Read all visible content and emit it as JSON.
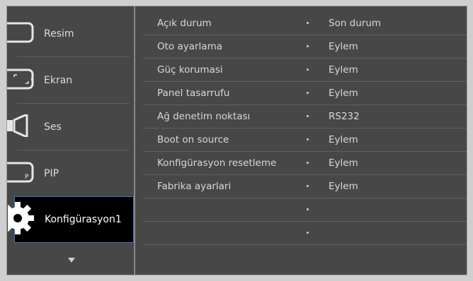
{
  "sidebar": {
    "items": [
      {
        "label": "Resim",
        "icon": "picture-icon"
      },
      {
        "label": "Ekran",
        "icon": "screen-icon"
      },
      {
        "label": "Ses",
        "icon": "speaker-icon"
      },
      {
        "label": "PIP",
        "icon": "pip-icon"
      },
      {
        "label": "Konfigürasyon1",
        "icon": "gear-icon",
        "selected": true
      }
    ],
    "more_arrow": "chevron-down-icon"
  },
  "menu": {
    "rows": [
      {
        "name": "Açık durum",
        "value": "Son durum"
      },
      {
        "name": "Oto ayarlama",
        "value": "Eylem"
      },
      {
        "name": "Güç korumasi",
        "value": "Eylem"
      },
      {
        "name": "Panel tasarrufu",
        "value": "Eylem"
      },
      {
        "name": "Ağ denetim noktası",
        "value": "RS232"
      },
      {
        "name": "Boot on source",
        "value": "Eylem"
      },
      {
        "name": "Konfigürasyon resetleme",
        "value": "Eylem"
      },
      {
        "name": "Fabrika ayarlari",
        "value": "Eylem"
      },
      {
        "name": "",
        "value": ""
      },
      {
        "name": "",
        "value": ""
      }
    ]
  },
  "colors": {
    "background": "#474747",
    "selected_bg": "#000000",
    "selected_border": "#3f6fc7",
    "text": "#d9d9d9"
  }
}
